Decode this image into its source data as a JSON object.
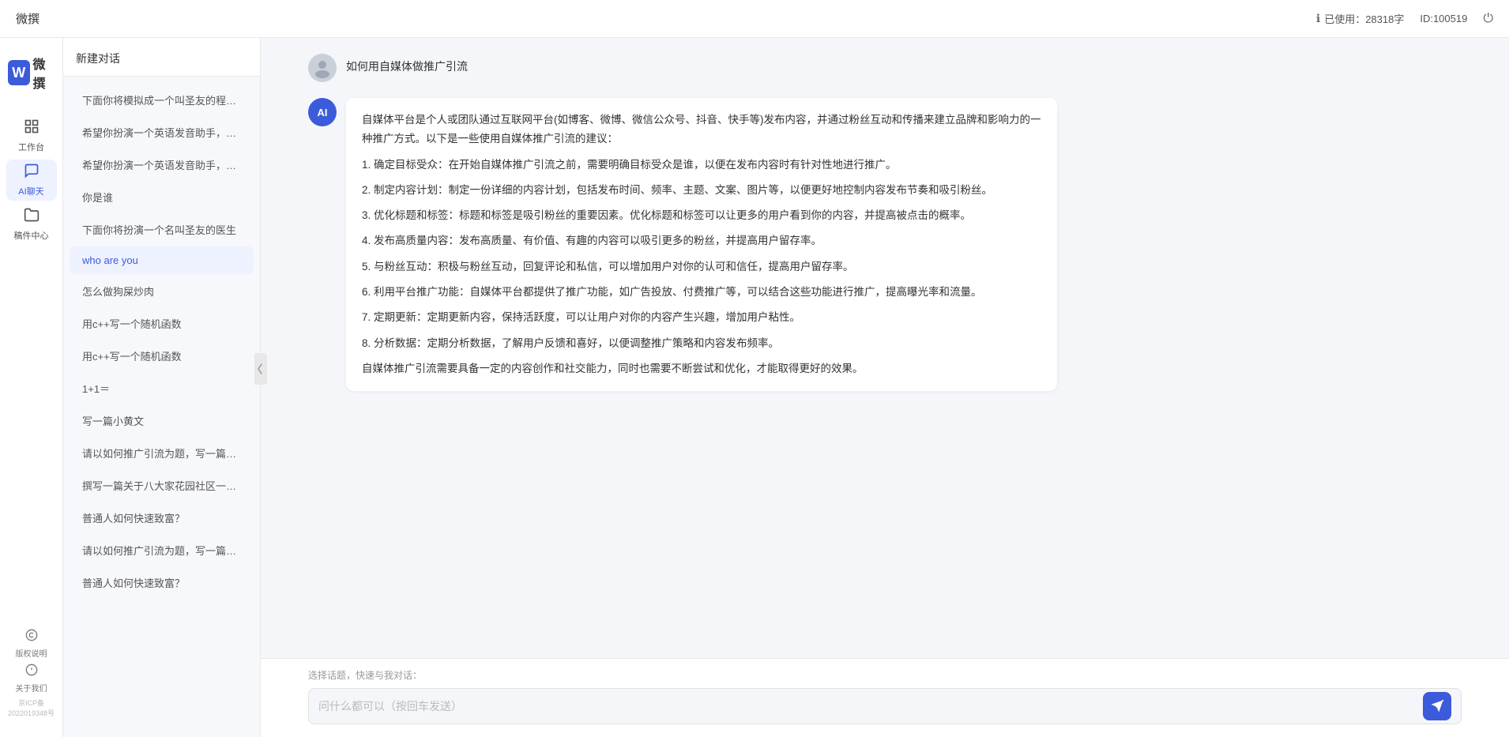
{
  "topbar": {
    "title": "微撰",
    "usage_label": "已使用：28318字",
    "id_label": "ID:100519",
    "usage_icon": "ℹ",
    "power_icon": "⏻"
  },
  "logo": {
    "w": "W",
    "text": "微撰"
  },
  "nav": {
    "items": [
      {
        "id": "workbench",
        "icon": "🖥",
        "label": "工作台"
      },
      {
        "id": "ai-chat",
        "icon": "💬",
        "label": "AI聊天"
      },
      {
        "id": "drafts",
        "icon": "📁",
        "label": "稿件中心"
      }
    ],
    "bottom_items": [
      {
        "id": "copyright",
        "icon": "©",
        "label": "版权说明"
      },
      {
        "id": "about",
        "icon": "ℹ",
        "label": "关于我们"
      }
    ],
    "icp": "京ICP备2022019348号"
  },
  "sidebar": {
    "new_chat": "新建对话",
    "chat_items": [
      {
        "id": 1,
        "text": "下面你将模拟成一个叫圣友的程序员，我说..."
      },
      {
        "id": 2,
        "text": "希望你扮演一个英语发音助手，我提供给你..."
      },
      {
        "id": 3,
        "text": "希望你扮演一个英语发音助手，我提供给你..."
      },
      {
        "id": 4,
        "text": "你是谁"
      },
      {
        "id": 5,
        "text": "下面你将扮演一个名叫圣友的医生"
      },
      {
        "id": 6,
        "text": "who are you"
      },
      {
        "id": 7,
        "text": "怎么做狗屎炒肉"
      },
      {
        "id": 8,
        "text": "用c++写一个随机函数"
      },
      {
        "id": 9,
        "text": "用c++写一个随机函数"
      },
      {
        "id": 10,
        "text": "1+1＝"
      },
      {
        "id": 11,
        "text": "写一篇小黄文"
      },
      {
        "id": 12,
        "text": "请以如何推广引流为题，写一篇大纲"
      },
      {
        "id": 13,
        "text": "撰写一篇关于八大家花园社区一刻钟便民生..."
      },
      {
        "id": 14,
        "text": "普通人如何快速致富？"
      },
      {
        "id": 15,
        "text": "请以如何推广引流为题，写一篇大纲"
      },
      {
        "id": 16,
        "text": "普通人如何快速致富？"
      }
    ]
  },
  "chat": {
    "user_question": "如何用自媒体做推广引流",
    "ai_avatar_text": "AI",
    "ai_response": {
      "intro": "自媒体平台是个人或团队通过互联网平台(如博客、微博、微信公众号、抖音、快手等)发布内容，并通过粉丝互动和传播来建立品牌和影响力的一种推广方式。以下是一些使用自媒体推广引流的建议：",
      "points": [
        "1. 确定目标受众：在开始自媒体推广引流之前，需要明确目标受众是谁，以便在发布内容时有针对性地进行推广。",
        "2. 制定内容计划：制定一份详细的内容计划，包括发布时间、频率、主题、文案、图片等，以便更好地控制内容发布节奏和吸引粉丝。",
        "3. 优化标题和标签：标题和标签是吸引粉丝的重要因素。优化标题和标签可以让更多的用户看到你的内容，并提高被点击的概率。",
        "4. 发布高质量内容：发布高质量、有价值、有趣的内容可以吸引更多的粉丝，并提高用户留存率。",
        "5. 与粉丝互动：积极与粉丝互动，回复评论和私信，可以增加用户对你的认可和信任，提高用户留存率。",
        "6. 利用平台推广功能：自媒体平台都提供了推广功能，如广告投放、付费推广等，可以结合这些功能进行推广，提高曝光率和流量。",
        "7. 定期更新：定期更新内容，保持活跃度，可以让用户对你的内容产生兴趣，增加用户粘性。",
        "8. 分析数据：定期分析数据，了解用户反馈和喜好，以便调整推广策略和内容发布频率。"
      ],
      "conclusion": "自媒体推广引流需要具备一定的内容创作和社交能力，同时也需要不断尝试和优化，才能取得更好的效果。"
    }
  },
  "input": {
    "quick_topics_label": "选择话题，快速与我对话：",
    "placeholder": "问什么都可以（按回车发送）"
  }
}
